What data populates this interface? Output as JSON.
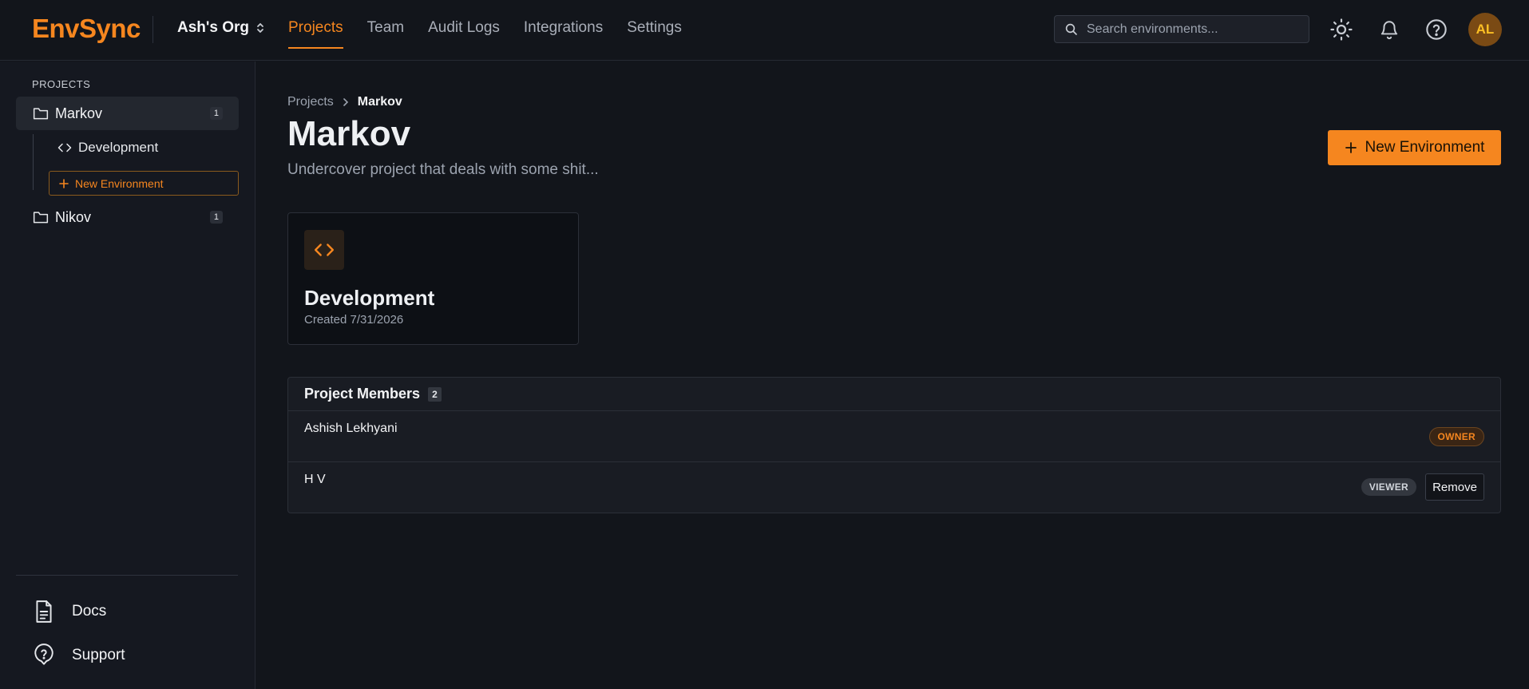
{
  "brand": {
    "name": "EnvSync",
    "accent": "#f5861f"
  },
  "org": {
    "name": "Ash's Org",
    "icon": "chevron-updown-icon"
  },
  "nav": {
    "items": [
      {
        "label": "Projects",
        "active": true
      },
      {
        "label": "Team"
      },
      {
        "label": "Audit Logs"
      },
      {
        "label": "Integrations"
      },
      {
        "label": "Settings"
      }
    ]
  },
  "search": {
    "placeholder": "Search environments..."
  },
  "header_icons": [
    "sun-icon",
    "bell-icon",
    "help-icon"
  ],
  "user": {
    "initials": "AL"
  },
  "sidebar": {
    "heading": "PROJECTS",
    "projects": [
      {
        "name": "Markov",
        "count": "1",
        "active": true,
        "environments": [
          {
            "name": "Development"
          }
        ]
      },
      {
        "name": "Nikov",
        "count": "1"
      }
    ],
    "new_environment_label": "New Environment",
    "links": [
      {
        "label": "Docs",
        "icon": "document-icon"
      },
      {
        "label": "Support",
        "icon": "support-icon"
      }
    ]
  },
  "breadcrumb": {
    "parent": "Projects",
    "current": "Markov"
  },
  "project": {
    "title": "Markov",
    "description": "Undercover project that deals with some shit..."
  },
  "new_environment_button": "New Environment",
  "environments": [
    {
      "name": "Development",
      "created": "Created 7/31/2026",
      "icon": "code-icon"
    }
  ],
  "members": {
    "title": "Project Members",
    "count": "2",
    "rows": [
      {
        "name": "Ashish Lekhyani",
        "role": "OWNER"
      },
      {
        "name": "H V",
        "role": "VIEWER",
        "action": "Remove"
      }
    ]
  }
}
